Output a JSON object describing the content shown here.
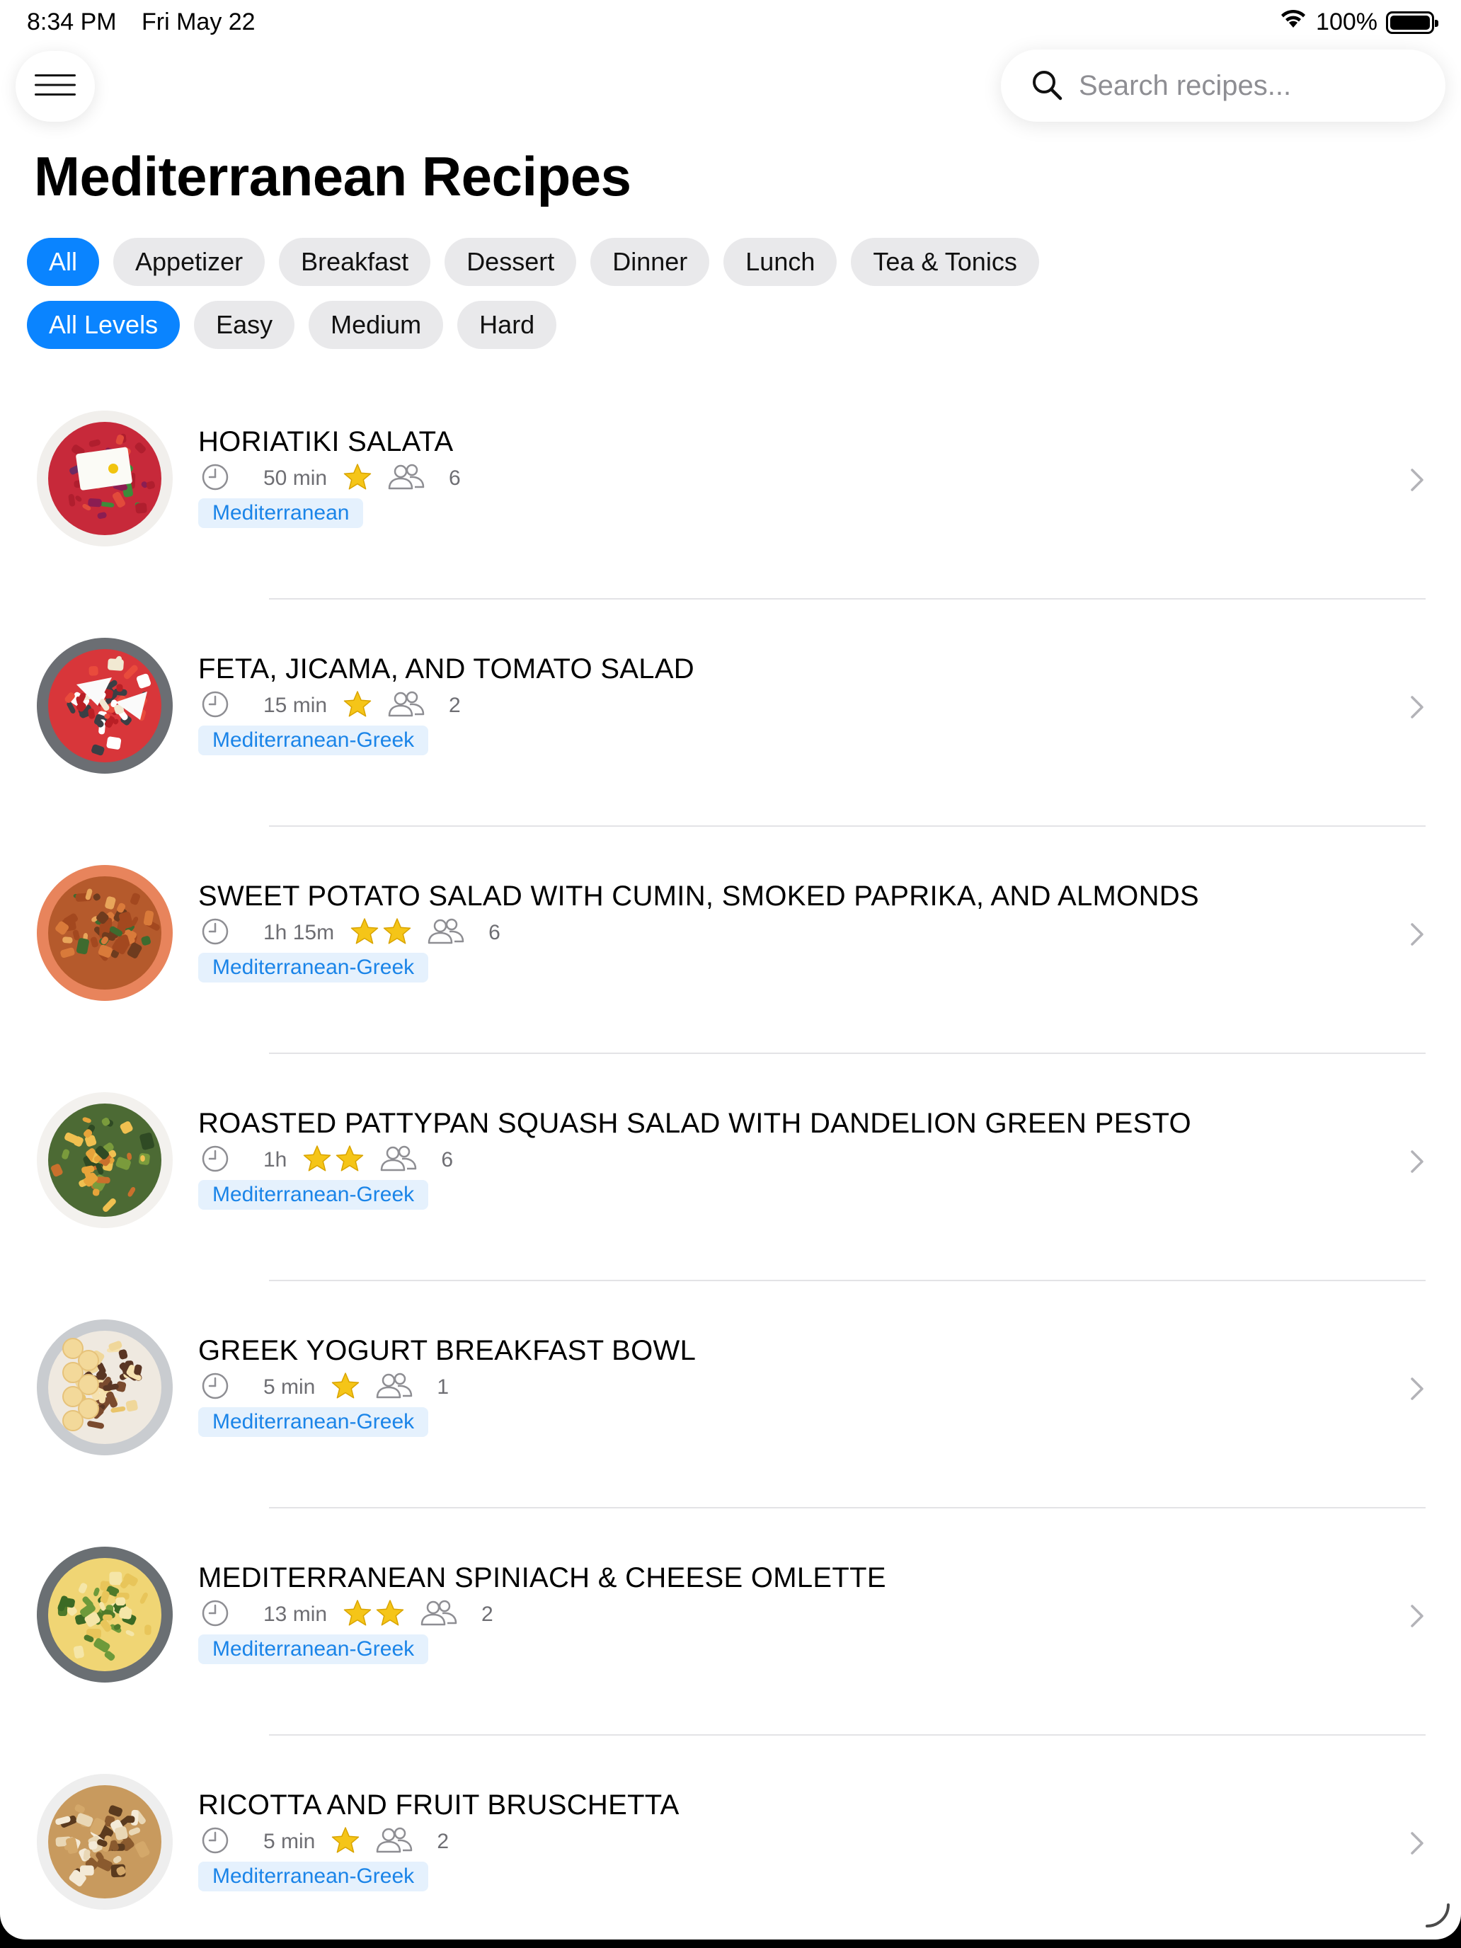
{
  "status_bar": {
    "time": "8:34 PM",
    "date": "Fri May 22",
    "battery_percent": "100%"
  },
  "search": {
    "placeholder": "Search recipes..."
  },
  "page_title": "Mediterranean Recipes",
  "category_filters": [
    {
      "label": "All",
      "selected": true
    },
    {
      "label": "Appetizer",
      "selected": false
    },
    {
      "label": "Breakfast",
      "selected": false
    },
    {
      "label": "Dessert",
      "selected": false
    },
    {
      "label": "Dinner",
      "selected": false
    },
    {
      "label": "Lunch",
      "selected": false
    },
    {
      "label": "Tea & Tonics",
      "selected": false
    }
  ],
  "level_filters": [
    {
      "label": "All Levels",
      "selected": true
    },
    {
      "label": "Easy",
      "selected": false
    },
    {
      "label": "Medium",
      "selected": false
    },
    {
      "label": "Hard",
      "selected": false
    }
  ],
  "recipes": [
    {
      "title": "HORIATIKI SALATA",
      "time": "50 min",
      "stars": 1,
      "servings": "6",
      "tag": "Mediterranean",
      "image": "greek-salad-bowl"
    },
    {
      "title": "FETA, JICAMA, AND TOMATO SALAD",
      "time": "15 min",
      "stars": 1,
      "servings": "2",
      "tag": "Mediterranean-Greek",
      "image": "feta-tomato-salad-plate"
    },
    {
      "title": "SWEET POTATO SALAD WITH CUMIN, SMOKED PAPRIKA, AND ALMONDS",
      "time": "1h 15m",
      "stars": 2,
      "servings": "6",
      "tag": "Mediterranean-Greek",
      "image": "sweet-potato-salad"
    },
    {
      "title": "ROASTED PATTYPAN SQUASH SALAD WITH DANDELION GREEN PESTO",
      "time": "1h",
      "stars": 2,
      "servings": "6",
      "tag": "Mediterranean-Greek",
      "image": "pattypan-squash-salad"
    },
    {
      "title": "GREEK YOGURT BREAKFAST BOWL",
      "time": "5 min",
      "stars": 1,
      "servings": "1",
      "tag": "Mediterranean-Greek",
      "image": "yogurt-banana-bowl"
    },
    {
      "title": "MEDITERRANEAN SPINIACH & CHEESE OMLETTE",
      "time": "13 min",
      "stars": 2,
      "servings": "2",
      "tag": "Mediterranean-Greek",
      "image": "spinach-omelette"
    },
    {
      "title": "RICOTTA AND FRUIT BRUSCHETTA",
      "time": "5 min",
      "stars": 1,
      "servings": "2",
      "tag": "Mediterranean-Greek",
      "image": "fruit-bruschetta"
    }
  ],
  "colors": {
    "accent": "#0a84ff",
    "chip_bg": "#e9e9eb",
    "tag_bg": "#e5f1fd",
    "tag_text": "#1a84e8",
    "star": "#f5c518",
    "meta_gray": "#6e6e73"
  }
}
